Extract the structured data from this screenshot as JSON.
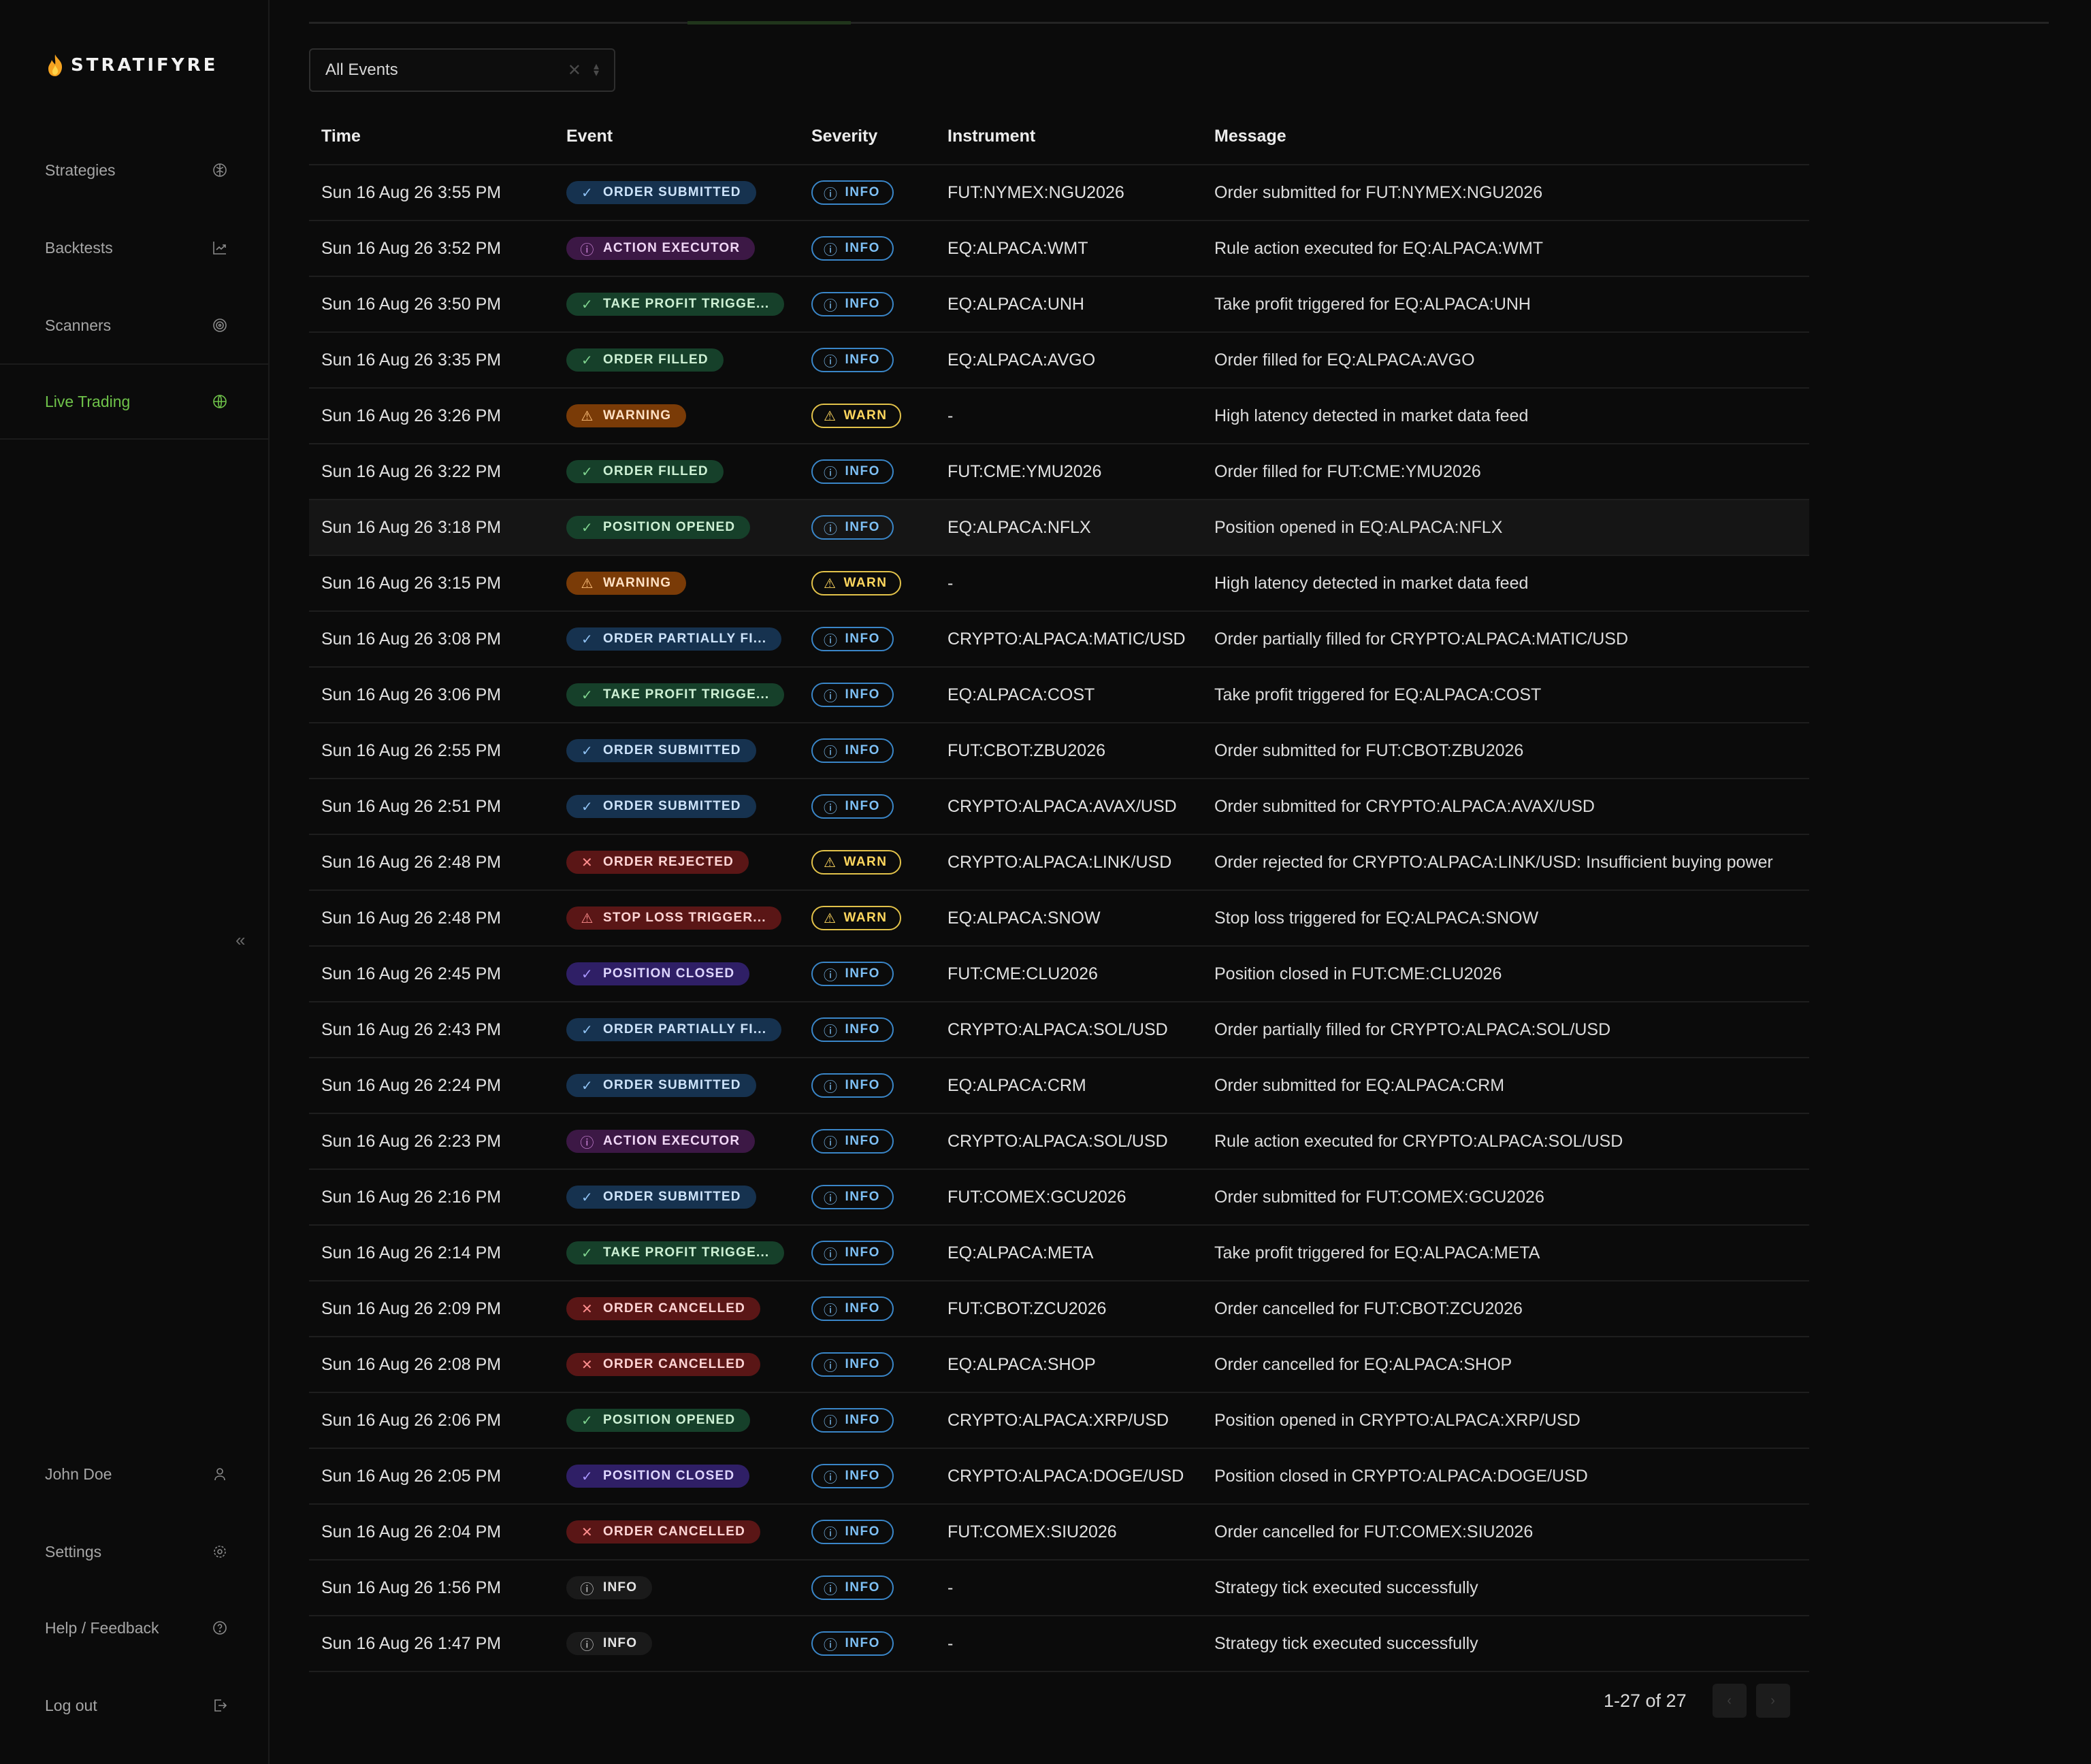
{
  "app": {
    "name": "STRATIFYRE"
  },
  "sidebar": {
    "nav": [
      {
        "label": "Strategies",
        "icon": "brain-icon"
      },
      {
        "label": "Backtests",
        "icon": "chart-arrow-icon"
      },
      {
        "label": "Scanners",
        "icon": "radar-icon"
      },
      {
        "label": "Live Trading",
        "icon": "globe-icon",
        "active": true
      }
    ],
    "collapse_glyph": "«",
    "bottom": [
      {
        "label": "John Doe",
        "icon": "user-icon"
      },
      {
        "label": "Settings",
        "icon": "gear-icon"
      },
      {
        "label": "Help / Feedback",
        "icon": "help-circle-icon"
      },
      {
        "label": "Log out",
        "icon": "logout-icon"
      }
    ]
  },
  "filter": {
    "value": "All Events",
    "clear_glyph": "✕"
  },
  "table": {
    "columns": [
      "Time",
      "Event",
      "Severity",
      "Instrument",
      "Message"
    ],
    "rows": [
      {
        "time": "Sun 16 Aug 26 3:55 PM",
        "event": "ORDER SUBMITTED",
        "event_style": "blue",
        "event_icon": "✓",
        "severity": "INFO",
        "instrument": "FUT:NYMEX:NGU2026",
        "message": "Order submitted for FUT:NYMEX:NGU2026"
      },
      {
        "time": "Sun 16 Aug 26 3:52 PM",
        "event": "ACTION EXECUTOR",
        "event_style": "purple",
        "event_icon": "ⓘ",
        "severity": "INFO",
        "instrument": "EQ:ALPACA:WMT",
        "message": "Rule action executed for EQ:ALPACA:WMT"
      },
      {
        "time": "Sun 16 Aug 26 3:50 PM",
        "event": "TAKE PROFIT TRIGGE...",
        "event_style": "green",
        "event_icon": "✓",
        "severity": "INFO",
        "instrument": "EQ:ALPACA:UNH",
        "message": "Take profit triggered for EQ:ALPACA:UNH"
      },
      {
        "time": "Sun 16 Aug 26 3:35 PM",
        "event": "ORDER FILLED",
        "event_style": "green",
        "event_icon": "✓",
        "severity": "INFO",
        "instrument": "EQ:ALPACA:AVGO",
        "message": "Order filled for EQ:ALPACA:AVGO"
      },
      {
        "time": "Sun 16 Aug 26 3:26 PM",
        "event": "WARNING",
        "event_style": "orange",
        "event_icon": "⚠",
        "severity": "WARN",
        "instrument": "-",
        "message": "High latency detected in market data feed"
      },
      {
        "time": "Sun 16 Aug 26 3:22 PM",
        "event": "ORDER FILLED",
        "event_style": "green",
        "event_icon": "✓",
        "severity": "INFO",
        "instrument": "FUT:CME:YMU2026",
        "message": "Order filled for FUT:CME:YMU2026"
      },
      {
        "time": "Sun 16 Aug 26 3:18 PM",
        "event": "POSITION OPENED",
        "event_style": "green",
        "event_icon": "✓",
        "severity": "INFO",
        "instrument": "EQ:ALPACA:NFLX",
        "message": "Position opened in EQ:ALPACA:NFLX",
        "highlight": true
      },
      {
        "time": "Sun 16 Aug 26 3:15 PM",
        "event": "WARNING",
        "event_style": "orange",
        "event_icon": "⚠",
        "severity": "WARN",
        "instrument": "-",
        "message": "High latency detected in market data feed"
      },
      {
        "time": "Sun 16 Aug 26 3:08 PM",
        "event": "ORDER PARTIALLY FI...",
        "event_style": "blue",
        "event_icon": "✓",
        "severity": "INFO",
        "instrument": "CRYPTO:ALPACA:MATIC/USD",
        "message": "Order partially filled for CRYPTO:ALPACA:MATIC/USD"
      },
      {
        "time": "Sun 16 Aug 26 3:06 PM",
        "event": "TAKE PROFIT TRIGGE...",
        "event_style": "green",
        "event_icon": "✓",
        "severity": "INFO",
        "instrument": "EQ:ALPACA:COST",
        "message": "Take profit triggered for EQ:ALPACA:COST"
      },
      {
        "time": "Sun 16 Aug 26 2:55 PM",
        "event": "ORDER SUBMITTED",
        "event_style": "blue",
        "event_icon": "✓",
        "severity": "INFO",
        "instrument": "FUT:CBOT:ZBU2026",
        "message": "Order submitted for FUT:CBOT:ZBU2026"
      },
      {
        "time": "Sun 16 Aug 26 2:51 PM",
        "event": "ORDER SUBMITTED",
        "event_style": "blue",
        "event_icon": "✓",
        "severity": "INFO",
        "instrument": "CRYPTO:ALPACA:AVAX/USD",
        "message": "Order submitted for CRYPTO:ALPACA:AVAX/USD"
      },
      {
        "time": "Sun 16 Aug 26 2:48 PM",
        "event": "ORDER REJECTED",
        "event_style": "red",
        "event_icon": "✕",
        "severity": "WARN",
        "instrument": "CRYPTO:ALPACA:LINK/USD",
        "message": "Order rejected for CRYPTO:ALPACA:LINK/USD: Insufficient buying power"
      },
      {
        "time": "Sun 16 Aug 26 2:48 PM",
        "event": "STOP LOSS TRIGGER...",
        "event_style": "red",
        "event_icon": "⚠",
        "severity": "WARN",
        "instrument": "EQ:ALPACA:SNOW",
        "message": "Stop loss triggered for EQ:ALPACA:SNOW"
      },
      {
        "time": "Sun 16 Aug 26 2:45 PM",
        "event": "POSITION CLOSED",
        "event_style": "violet",
        "event_icon": "✓",
        "severity": "INFO",
        "instrument": "FUT:CME:CLU2026",
        "message": "Position closed in FUT:CME:CLU2026"
      },
      {
        "time": "Sun 16 Aug 26 2:43 PM",
        "event": "ORDER PARTIALLY FI...",
        "event_style": "blue",
        "event_icon": "✓",
        "severity": "INFO",
        "instrument": "CRYPTO:ALPACA:SOL/USD",
        "message": "Order partially filled for CRYPTO:ALPACA:SOL/USD"
      },
      {
        "time": "Sun 16 Aug 26 2:24 PM",
        "event": "ORDER SUBMITTED",
        "event_style": "blue",
        "event_icon": "✓",
        "severity": "INFO",
        "instrument": "EQ:ALPACA:CRM",
        "message": "Order submitted for EQ:ALPACA:CRM"
      },
      {
        "time": "Sun 16 Aug 26 2:23 PM",
        "event": "ACTION EXECUTOR",
        "event_style": "purple",
        "event_icon": "ⓘ",
        "severity": "INFO",
        "instrument": "CRYPTO:ALPACA:SOL/USD",
        "message": "Rule action executed for CRYPTO:ALPACA:SOL/USD"
      },
      {
        "time": "Sun 16 Aug 26 2:16 PM",
        "event": "ORDER SUBMITTED",
        "event_style": "blue",
        "event_icon": "✓",
        "severity": "INFO",
        "instrument": "FUT:COMEX:GCU2026",
        "message": "Order submitted for FUT:COMEX:GCU2026"
      },
      {
        "time": "Sun 16 Aug 26 2:14 PM",
        "event": "TAKE PROFIT TRIGGE...",
        "event_style": "green",
        "event_icon": "✓",
        "severity": "INFO",
        "instrument": "EQ:ALPACA:META",
        "message": "Take profit triggered for EQ:ALPACA:META"
      },
      {
        "time": "Sun 16 Aug 26 2:09 PM",
        "event": "ORDER CANCELLED",
        "event_style": "red",
        "event_icon": "✕",
        "severity": "INFO",
        "instrument": "FUT:CBOT:ZCU2026",
        "message": "Order cancelled for FUT:CBOT:ZCU2026"
      },
      {
        "time": "Sun 16 Aug 26 2:08 PM",
        "event": "ORDER CANCELLED",
        "event_style": "red",
        "event_icon": "✕",
        "severity": "INFO",
        "instrument": "EQ:ALPACA:SHOP",
        "message": "Order cancelled for EQ:ALPACA:SHOP"
      },
      {
        "time": "Sun 16 Aug 26 2:06 PM",
        "event": "POSITION OPENED",
        "event_style": "green",
        "event_icon": "✓",
        "severity": "INFO",
        "instrument": "CRYPTO:ALPACA:XRP/USD",
        "message": "Position opened in CRYPTO:ALPACA:XRP/USD"
      },
      {
        "time": "Sun 16 Aug 26 2:05 PM",
        "event": "POSITION CLOSED",
        "event_style": "violet",
        "event_icon": "✓",
        "severity": "INFO",
        "instrument": "CRYPTO:ALPACA:DOGE/USD",
        "message": "Position closed in CRYPTO:ALPACA:DOGE/USD"
      },
      {
        "time": "Sun 16 Aug 26 2:04 PM",
        "event": "ORDER CANCELLED",
        "event_style": "red",
        "event_icon": "✕",
        "severity": "INFO",
        "instrument": "FUT:COMEX:SIU2026",
        "message": "Order cancelled for FUT:COMEX:SIU2026"
      },
      {
        "time": "Sun 16 Aug 26 1:56 PM",
        "event": "INFO",
        "event_style": "gray",
        "event_icon": "ⓘ",
        "severity": "INFO",
        "instrument": "-",
        "message": "Strategy tick executed successfully"
      },
      {
        "time": "Sun 16 Aug 26 1:47 PM",
        "event": "INFO",
        "event_style": "gray",
        "event_icon": "ⓘ",
        "severity": "INFO",
        "instrument": "-",
        "message": "Strategy tick executed successfully"
      }
    ]
  },
  "pagination": {
    "text": "1-27 of 27",
    "prev_glyph": "‹",
    "next_glyph": "›"
  },
  "colors": {
    "background": "#0b0b0b",
    "accent_green": "#6fc34a",
    "info_blue": "#7ec0f5",
    "warn_yellow": "#ffd75e"
  }
}
